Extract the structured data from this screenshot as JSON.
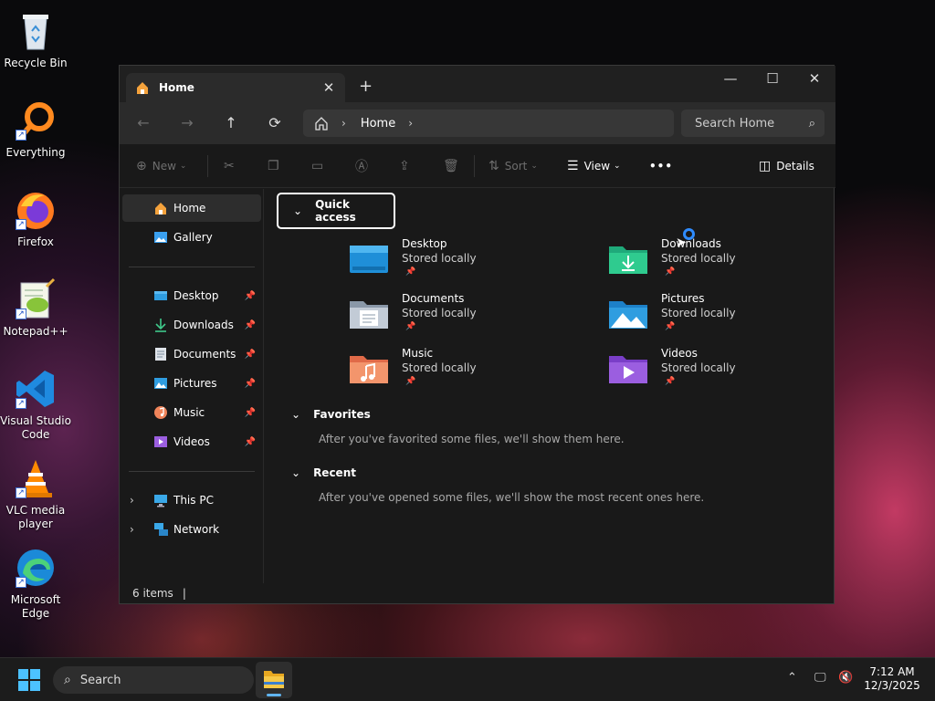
{
  "desktop": {
    "icons": [
      {
        "label": "Recycle Bin",
        "icon": "recycle-bin-icon"
      },
      {
        "label": "Everything",
        "icon": "everything-icon"
      },
      {
        "label": "Firefox",
        "icon": "firefox-icon"
      },
      {
        "label": "Notepad++",
        "icon": "notepad-plus-plus-icon"
      },
      {
        "label": "Visual Studio Code",
        "icon": "vscode-icon"
      },
      {
        "label": "VLC media player",
        "icon": "vlc-icon"
      },
      {
        "label": "Microsoft Edge",
        "icon": "edge-icon"
      }
    ]
  },
  "window": {
    "tab_title": "Home",
    "tab_close": "✕",
    "new_tab": "+",
    "controls": {
      "minimize": "—",
      "maximize": "☐",
      "close": "✕"
    },
    "nav": {
      "back": "←",
      "forward": "→",
      "up": "↑",
      "refresh": "⟳"
    },
    "address": {
      "crumb": "Home",
      "sep": "›"
    },
    "search_placeholder": "Search Home",
    "commands": {
      "new": "New",
      "sort": "Sort",
      "view": "View",
      "more": "•••",
      "details": "Details"
    },
    "sidebar": {
      "home": "Home",
      "gallery": "Gallery",
      "pinned": [
        {
          "label": "Desktop",
          "icon": "desktop-folder-icon"
        },
        {
          "label": "Downloads",
          "icon": "downloads-icon"
        },
        {
          "label": "Documents",
          "icon": "documents-icon"
        },
        {
          "label": "Pictures",
          "icon": "pictures-icon"
        },
        {
          "label": "Music",
          "icon": "music-icon"
        },
        {
          "label": "Videos",
          "icon": "videos-icon"
        }
      ],
      "this_pc": "This PC",
      "network": "Network"
    },
    "quick_access": {
      "title": "Quick access",
      "items": [
        {
          "name": "Desktop",
          "sub": "Stored locally",
          "icon": "desktop-folder-icon"
        },
        {
          "name": "Downloads",
          "sub": "Stored locally",
          "icon": "downloads-folder-icon"
        },
        {
          "name": "Documents",
          "sub": "Stored locally",
          "icon": "documents-folder-icon"
        },
        {
          "name": "Pictures",
          "sub": "Stored locally",
          "icon": "pictures-folder-icon"
        },
        {
          "name": "Music",
          "sub": "Stored locally",
          "icon": "music-folder-icon"
        },
        {
          "name": "Videos",
          "sub": "Stored locally",
          "icon": "videos-folder-icon"
        }
      ]
    },
    "favorites": {
      "title": "Favorites",
      "message": "After you've favorited some files, we'll show them here."
    },
    "recent": {
      "title": "Recent",
      "message": "After you've opened some files, we'll show the most recent ones here."
    },
    "status": "6 items"
  },
  "taskbar": {
    "search_placeholder": "Search",
    "time": "7:12 AM",
    "date": "12/3/2025"
  },
  "colors": {
    "accent": "#2f8cff",
    "folder": "#f3c34f"
  }
}
